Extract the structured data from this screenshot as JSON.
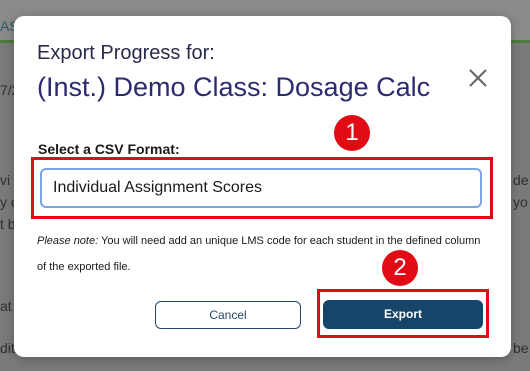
{
  "background": {
    "fragments": [
      "AS",
      "7/2",
      "vi",
      "y c",
      "t b",
      "at",
      "dit",
      "de",
      "yo",
      "be"
    ]
  },
  "modal": {
    "subtitle": "Export Progress for:",
    "title": "(Inst.) Demo Class: Dosage Calc",
    "close_icon": "close-icon",
    "field_label": "Select a CSV Format:",
    "format_value": "Individual Assignment Scores",
    "note_prefix": "Please note:",
    "note_text": " You will need add an unique LMS code for each student in the defined column of the exported file.",
    "cancel_label": "Cancel",
    "export_label": "Export"
  },
  "annotations": {
    "badge_1": "1",
    "badge_2": "2",
    "color": "#e00b14"
  },
  "colors": {
    "title": "#2d2a6e",
    "export_button": "#17456a",
    "focus_border": "#7aa6e8",
    "overlay": "#7a7a7a"
  }
}
